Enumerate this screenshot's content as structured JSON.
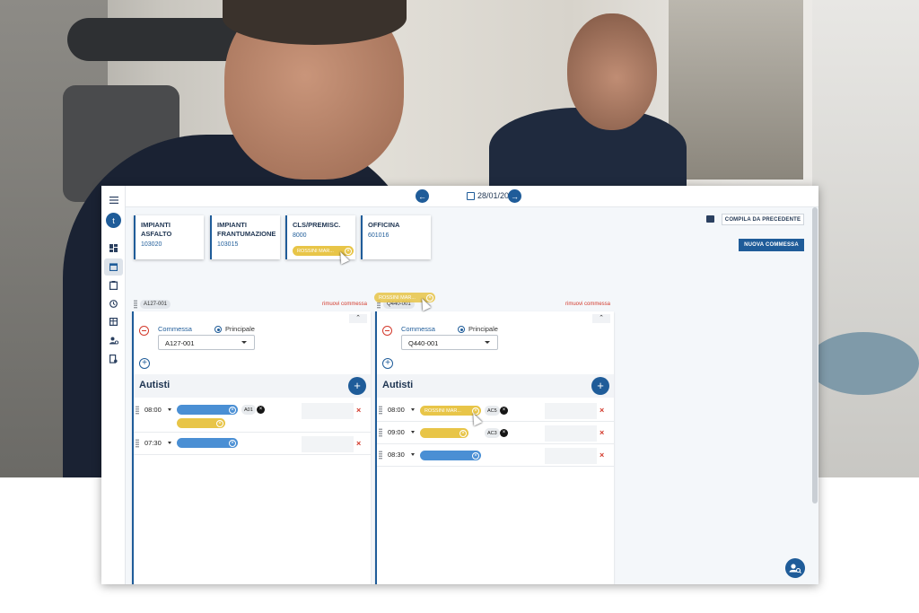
{
  "topbar": {
    "date": "28/01/2022"
  },
  "sidebar": {
    "avatar_letter": "t"
  },
  "cards": [
    {
      "title": "IMPIANTI ASFALTO",
      "code": "103020"
    },
    {
      "title": "IMPIANTI FRANTUMAZIONE",
      "code": "103015"
    },
    {
      "title": "CLS/PREMISC.",
      "code": "8000",
      "chip": "ROSSINI MAR..."
    },
    {
      "title": "OFFICINA",
      "code": "601016"
    }
  ],
  "actions": {
    "compila": "COMPILA DA PRECEDENTE",
    "nuova": "NUOVA COMMESSA"
  },
  "dragged_chip": "ROSSINI MAR...",
  "columns": [
    {
      "tag": "A127-001",
      "remove": "rimuovi commessa",
      "commessa_label": "Commessa",
      "principale_label": "Principale",
      "select_value": "A127-001",
      "section_title": "Autisti",
      "rows": [
        {
          "time": "08:00",
          "badge": "A01"
        },
        {
          "time": "07:30"
        }
      ]
    },
    {
      "tag": "Q440-001",
      "remove": "rimuovi commessa",
      "commessa_label": "Commessa",
      "principale_label": "Principale",
      "select_value": "Q440-001",
      "section_title": "Autisti",
      "rows": [
        {
          "time": "08:00",
          "chip": "ROSSINI MAR...",
          "badge": "AC5"
        },
        {
          "time": "09:00",
          "badge": "AC3"
        },
        {
          "time": "08:30"
        }
      ]
    }
  ],
  "colors": {
    "primary": "#1f5c99",
    "yellow_chip": "#e8c548",
    "blue_chip": "#4a8fd4",
    "danger": "#d33a2c"
  }
}
